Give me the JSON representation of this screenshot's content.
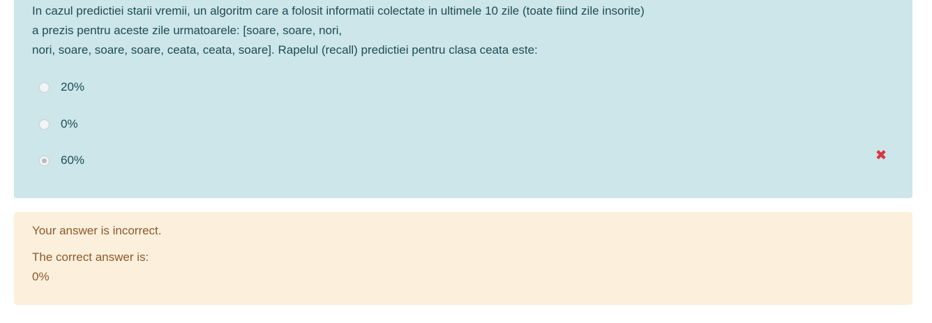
{
  "question": {
    "lines": [
      "In cazul predictiei starii vremii, un algoritm care a folosit informatii colectate in ultimele 10 zile (toate fiind zile insorite)",
      "a prezis pentru aceste zile urmatoarele: [soare, soare, nori,",
      "nori, soare, soare, soare, ceata, ceata, soare]. Rapelul (recall) predictiei pentru clasa ceata este:"
    ],
    "options": [
      {
        "label": "20%",
        "selected": false
      },
      {
        "label": "0%",
        "selected": false
      },
      {
        "label": "60%",
        "selected": true
      }
    ],
    "status_icon": "incorrect-x-icon",
    "accent_color": "#cce6ea",
    "incorrect_color": "#d9363e"
  },
  "feedback": {
    "status": "Your answer is incorrect.",
    "correct_label": "The correct answer is:",
    "correct_value": "0%",
    "background_color": "#fcefdc"
  }
}
